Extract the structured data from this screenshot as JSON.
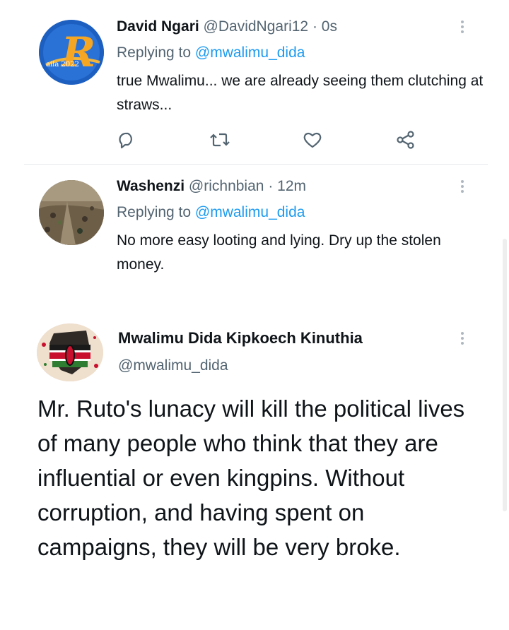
{
  "replies": [
    {
      "name": "David Ngari",
      "handle": "@DavidNgari12",
      "time": "· 0s",
      "replying_prefix": "Replying to",
      "replying_handle": "@mwalimu_dida",
      "text": "true Mwalimu... we are already seeing them clutching at straws...",
      "avatar_text": "R",
      "avatar_caption": "aila 2022"
    },
    {
      "name": "Washenzi",
      "handle": "@richnbian",
      "time": "· 12m",
      "replying_prefix": "Replying to",
      "replying_handle": "@mwalimu_dida",
      "text": "No more easy looting and lying. Dry up the stolen money."
    }
  ],
  "main_tweet": {
    "name": "Mwalimu Dida Kipkoech Kinuthia",
    "handle": "@mwalimu_dida",
    "text": "Mr. Ruto's lunacy will kill the political lives of many people who think that they are influential or even kingpins. Without corruption, and having spent on campaigns, they will be very broke."
  },
  "icons": [
    "reply-icon",
    "retweet-icon",
    "like-icon",
    "share-icon",
    "more-options-icon"
  ],
  "colors": {
    "accent": "#1d9bf0",
    "muted": "#536471",
    "text": "#0f1419"
  }
}
